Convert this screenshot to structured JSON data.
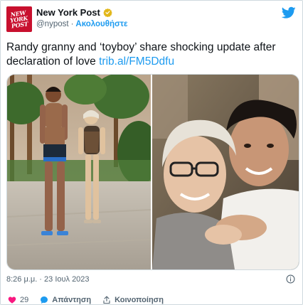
{
  "account": {
    "display_name": "New York Post",
    "handle": "@nypost",
    "follow_label": "Ακολουθήστε",
    "avatar_text": "NEW YORK POST"
  },
  "tweet": {
    "text": "Randy granny and ‘toyboy’ share shocking update after declaration of love ",
    "link": "trib.al/FM5Ddfu"
  },
  "meta": {
    "timestamp": "8:26 μ.μ. · 23 Ιουλ 2023"
  },
  "actions": {
    "like_count": "29",
    "reply_label": "Απάντηση",
    "share_label": "Κοινοποίηση"
  },
  "colors": {
    "brand_red": "#c8102e",
    "link_blue": "#1d9bf0",
    "like_pink": "#f91880",
    "muted_text": "#536471",
    "verified_gold": "#e2b719"
  },
  "icons": [
    "verified-badge-icon",
    "twitter-bird-icon",
    "info-icon",
    "heart-icon",
    "reply-icon",
    "share-icon"
  ]
}
